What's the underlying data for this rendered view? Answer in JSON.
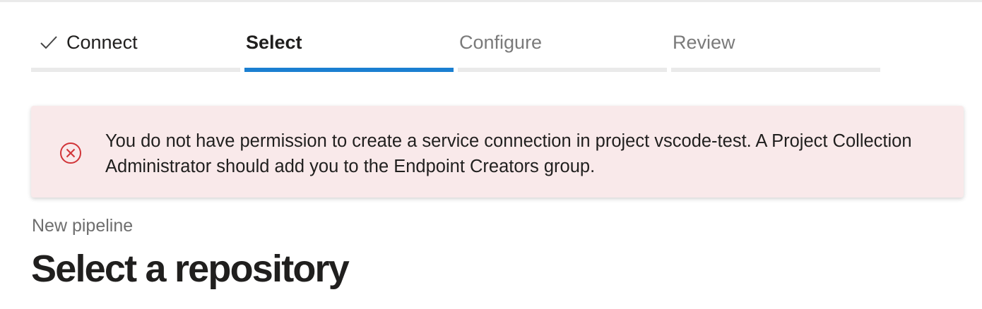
{
  "wizard": {
    "steps": [
      {
        "label": "Connect",
        "state": "done"
      },
      {
        "label": "Select",
        "state": "active"
      },
      {
        "label": "Configure",
        "state": "pending"
      },
      {
        "label": "Review",
        "state": "pending"
      }
    ],
    "active_color": "#1b7fd1",
    "inactive_color": "#eaeaea"
  },
  "error_banner": {
    "icon": "error-circle-x-icon",
    "message": "You do not have permission to create a service connection in project vscode-test. A Project Collection Administrator should add you to the Endpoint Creators group.",
    "background_color": "#f9e9ea",
    "icon_color": "#d13438"
  },
  "page": {
    "breadcrumb": "New pipeline",
    "title": "Select a repository"
  }
}
